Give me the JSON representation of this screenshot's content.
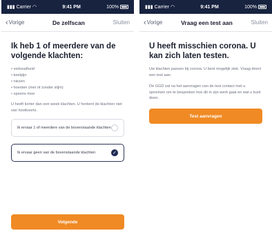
{
  "screens": [
    {
      "statusbar": {
        "carrier": "Carrier",
        "time": "9:41 PM",
        "battery": "100%"
      },
      "nav": {
        "back": "Vorige",
        "title": "De zelfscan",
        "close": "Sluiten"
      },
      "heading": "Ik heb 1 of meerdere van de volgende klachten:",
      "symptoms": [
        "verkoudheid",
        "keelpijn",
        "niezen",
        "hoesten (met of zonder slijm)",
        "opeens moe"
      ],
      "note": "U heeft korter dan een week klachten. U herkent de klachten niet van hooikoorts.",
      "options": [
        {
          "label": "Ik ervaar 1 of meerdere van de bovenstaande klachten",
          "selected": false
        },
        {
          "label": "Ik ervaar geen van de bovenstaande klachten",
          "selected": true
        }
      ],
      "button": "Volgende"
    },
    {
      "statusbar": {
        "carrier": "Carrier",
        "time": "9:41 PM",
        "battery": "100%"
      },
      "nav": {
        "back": "Vorige",
        "title": "Vraag een test aan",
        "close": "Sluiten"
      },
      "heading": "U heeft misschien corona. U kan zich laten testen.",
      "para1": "Uw klachten passen bij corona. U bent mogelijk ziek. Vraag direct een test aan.",
      "para2": "De GGD zal na het aanvragen van de test contact met u opnemen om te bespreken hoe dit in zijn werk gaat en wat u kunt doen.",
      "button": "Test aanvragen"
    }
  ],
  "colors": {
    "statusbar": "#17233f",
    "accent": "#f08a24",
    "selected": "#1d2a52"
  }
}
